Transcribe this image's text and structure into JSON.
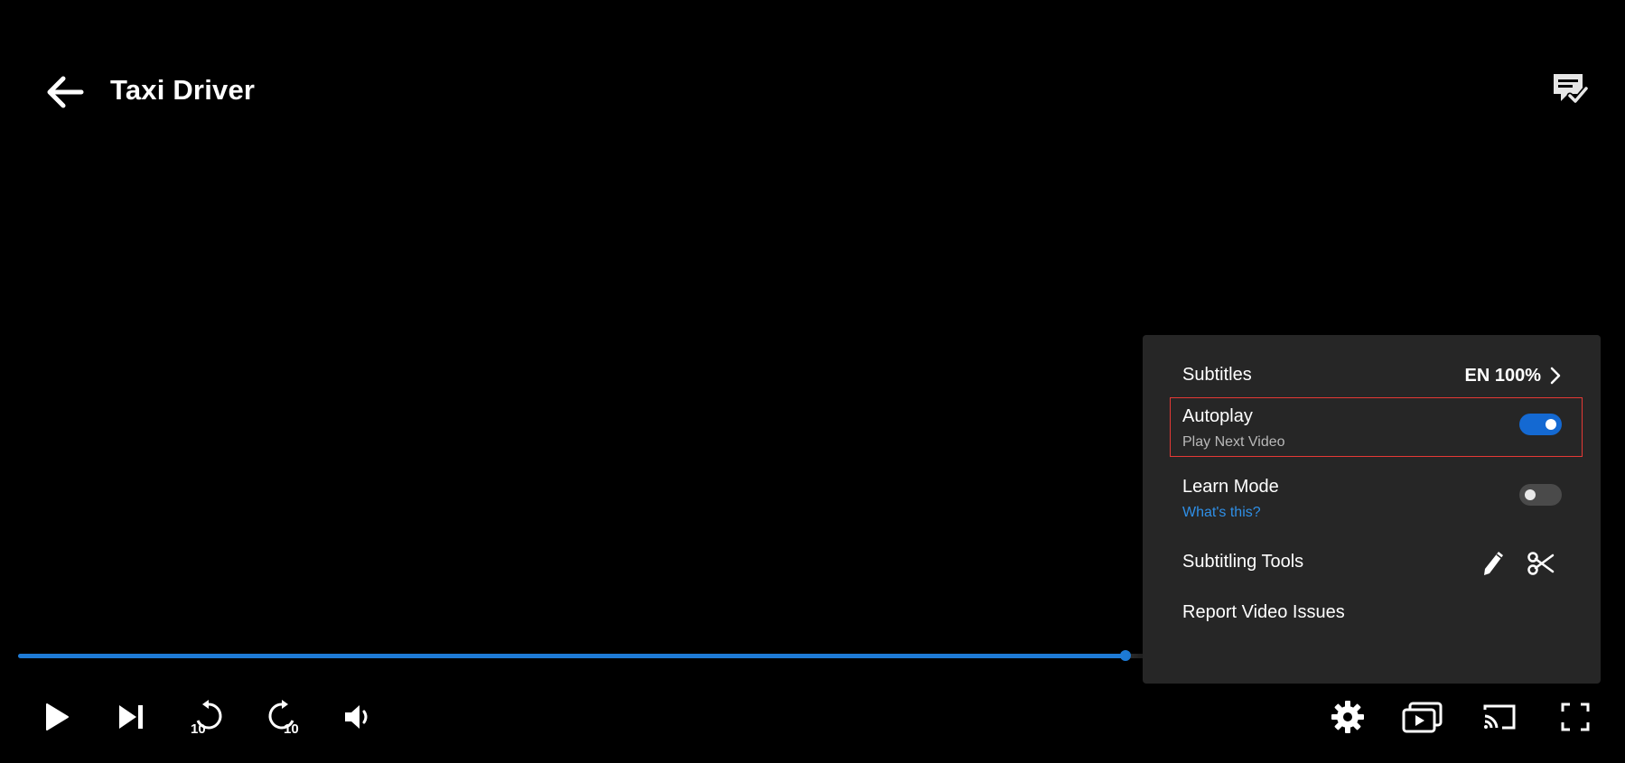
{
  "header": {
    "title": "Taxi Driver",
    "back_icon": "arrow-left-icon",
    "subtitles_icon": "subtitle-check-icon"
  },
  "progress": {
    "fraction": 0.7,
    "color": "#1e7bd6"
  },
  "controls": {
    "left": [
      {
        "name": "play-button",
        "icon": "play-icon"
      },
      {
        "name": "next-button",
        "icon": "skip-next-icon"
      },
      {
        "name": "rewind-10-button",
        "icon": "replay-10-icon",
        "label": "10"
      },
      {
        "name": "forward-10-button",
        "icon": "forward-10-icon",
        "label": "10"
      },
      {
        "name": "volume-button",
        "icon": "volume-icon"
      }
    ],
    "right": [
      {
        "name": "settings-button",
        "icon": "gear-icon"
      },
      {
        "name": "picture-in-picture-button",
        "icon": "pip-icon"
      },
      {
        "name": "cast-button",
        "icon": "cast-icon"
      },
      {
        "name": "fullscreen-button",
        "icon": "fullscreen-icon"
      }
    ]
  },
  "settings_menu": {
    "subtitles": {
      "label": "Subtitles",
      "value": "EN 100%"
    },
    "autoplay": {
      "label": "Autoplay",
      "sub": "Play Next Video",
      "enabled": true
    },
    "learn_mode": {
      "label": "Learn Mode",
      "link": "What's this?",
      "enabled": false
    },
    "subtitling_tools": {
      "label": "Subtitling Tools",
      "icons": [
        "pencil-icon",
        "scissors-icon"
      ]
    },
    "report": {
      "label": "Report Video Issues"
    }
  },
  "colors": {
    "accent": "#1e7bd6",
    "menu_bg": "#262626",
    "link": "#2f8fe6",
    "highlight_border": "#e53935"
  }
}
